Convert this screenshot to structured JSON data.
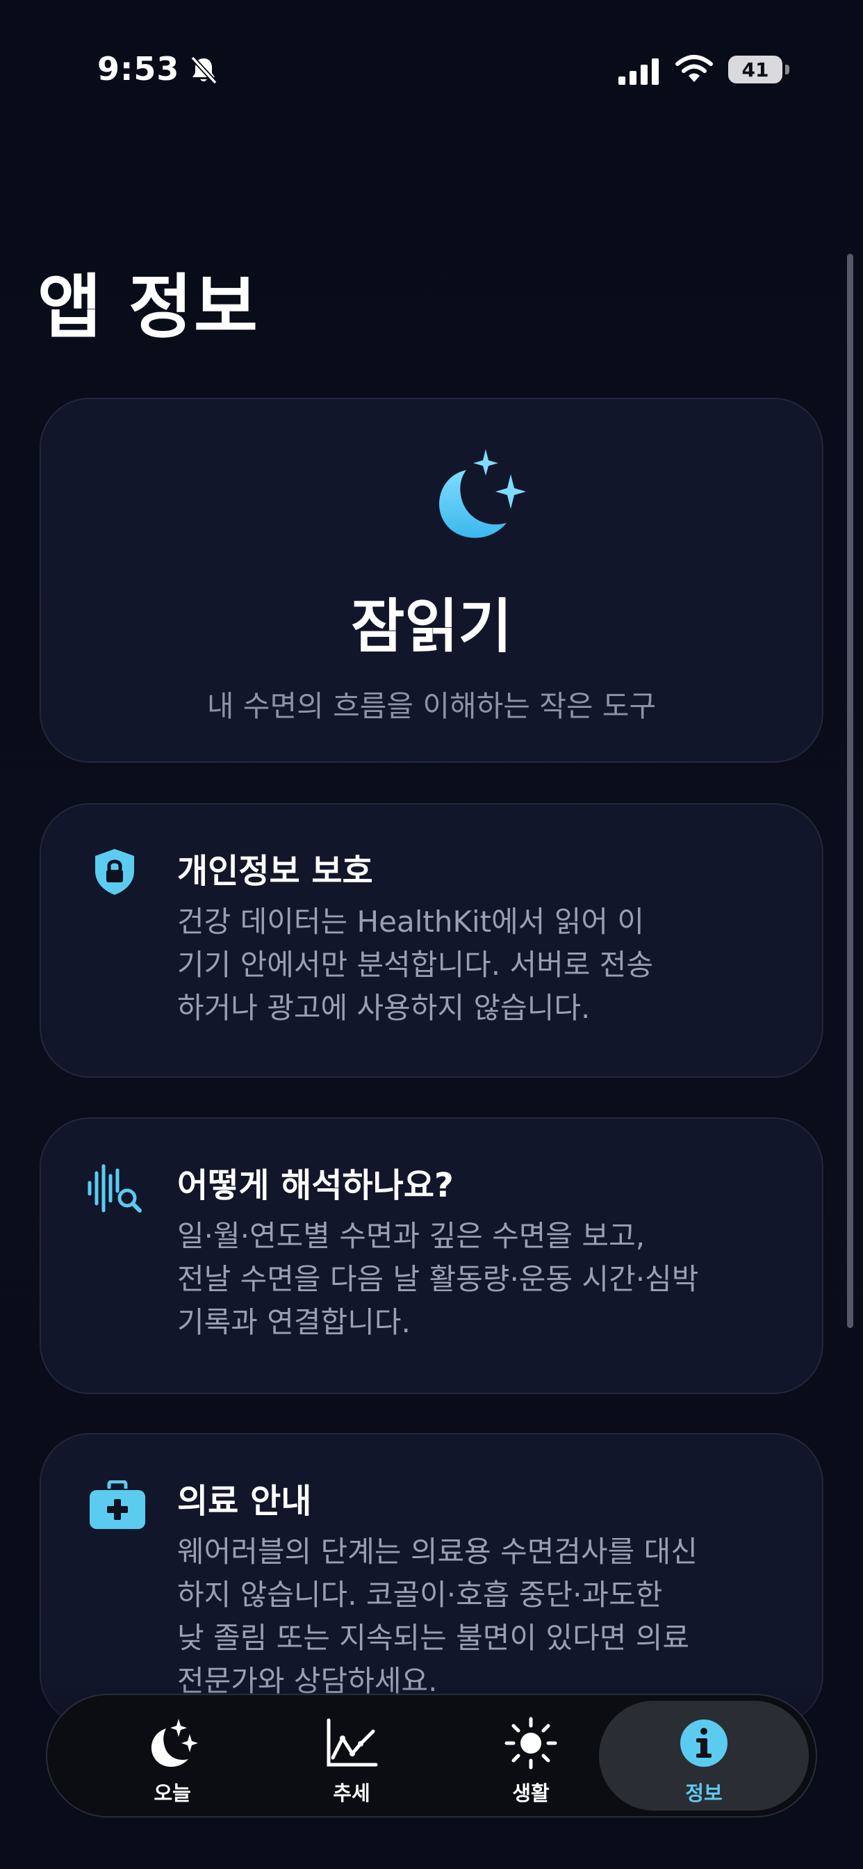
{
  "status_bar": {
    "time": "9:53",
    "battery": "41"
  },
  "page": {
    "title": "앱 정보"
  },
  "hero": {
    "app_name": "잠읽기",
    "tagline": "내 수면의 흐름을 이해하는 작은 도구"
  },
  "cards": [
    {
      "title": "개인정보 보호",
      "body": [
        "건강 데이터는 HealthKit에서 읽어 이",
        "기기 안에서만 분석합니다. 서버로 전송",
        "하거나 광고에 사용하지 않습니다."
      ]
    },
    {
      "title": "어떻게 해석하나요?",
      "body": [
        "일·월·연도별 수면과 깊은 수면을 보고,",
        "전날 수면을 다음 날 활동량·운동 시간·심박",
        "기록과 연결합니다."
      ]
    },
    {
      "title": "의료 안내",
      "body": [
        "웨어러블의 단계는 의료용 수면검사를 대신",
        "하지 않습니다. 코골이·호흡 중단·과도한",
        "낮 졸림 또는 지속되는 불면이 있다면 의료",
        "전문가와 상담하세요."
      ]
    }
  ],
  "tabs": [
    {
      "label": "오늘",
      "icon": "moon-stars-icon"
    },
    {
      "label": "추세",
      "icon": "trend-chart-icon"
    },
    {
      "label": "생활",
      "icon": "sun-icon"
    },
    {
      "label": "정보",
      "icon": "info-icon",
      "selected": true
    }
  ],
  "colors": {
    "accent": "#5ccbf0",
    "background": "#0a0d1a",
    "card": "#12162a",
    "secondary_text": "#9a9fb2"
  }
}
